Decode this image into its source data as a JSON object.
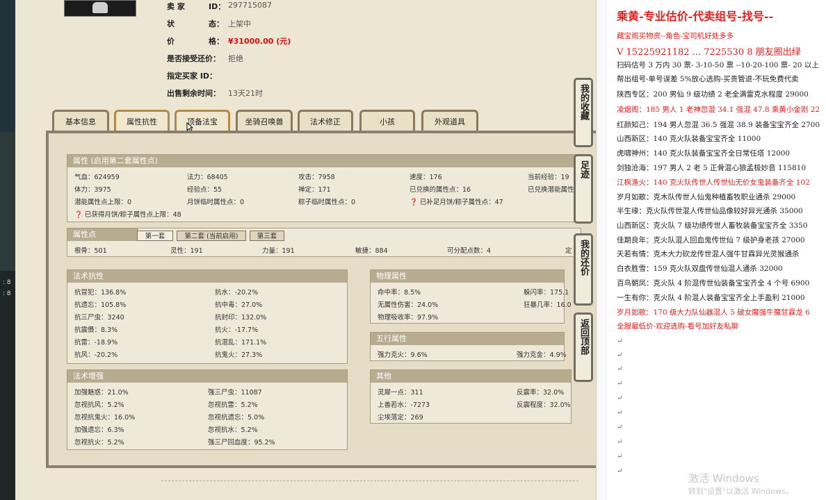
{
  "seller_info": {
    "seller_label": "卖    家",
    "id_label": "ID：",
    "id_value": "297715087",
    "status_label": "状",
    "status_label2": "态：",
    "status_value": "上架中",
    "price_label": "价",
    "price_label2": "格：",
    "price_value": "¥31000.00 (元)",
    "counter_label": "是否接受还价：",
    "counter_value": "拒绝",
    "buyer_label": "指定买家 ID：",
    "time_label": "出售剩余时间：",
    "time_value": "13天21时"
  },
  "tabs": [
    "基本信息",
    "属性抗性",
    "顶备法宝",
    "坐骑召唤兽",
    "法术修正",
    "小孩",
    "外观道具"
  ],
  "attributes": {
    "header": "属性 (启用第二套属性点)",
    "cells": [
      "气血：624959",
      "法力：68405",
      "攻击：7958",
      "速度：176",
      "当前经验：19",
      "体力：3975",
      "经验点：55",
      "禅定：171",
      "已兑换的属性点：16",
      "已兑换潜能属性",
      "潜能属性点上限：0",
      "月饼临时属性点：0",
      "粽子临时属性点：0",
      "已补足月饼/粽子属性点：47"
    ],
    "note": "已获得月饼/粽子属性点上限：48"
  },
  "points": {
    "header": "属性点",
    "subtabs": [
      "第一套",
      "第二套 (当前启用)",
      "第三套"
    ],
    "cells": [
      "根骨：501",
      "灵性：191",
      "力量：191",
      "敏捷：884",
      "可分配点数：4",
      "定"
    ]
  },
  "magic_resist": {
    "header": "法术抗性",
    "cells": [
      "抗冒犯：136.8%",
      "抗水：-20.2%",
      "抗遗忘：105.8%",
      "抗中毒：27.0%",
      "抗三尸虫：3240",
      "抗封印：132.0%",
      "抗震慑：8.3%",
      "抗火：-17.7%",
      "抗雷：-18.9%",
      "抗混乱：171.1%",
      "抗风：-20.2%",
      "抗鬼火：27.3%"
    ]
  },
  "physical": {
    "header": "物理属性",
    "cells": [
      "命中率：8.5%",
      "躲闪率：175.1",
      "无属性伤害：24.0%",
      "狂暴几率：16.0",
      "物理吸收率：97.9%"
    ]
  },
  "magic_boost": {
    "header": "法术增强",
    "cells": [
      "加强魅惑：21.0%",
      "强三尸虫：11087",
      "忽视抗风：5.2%",
      "忽视抗雷：5.2%",
      "忽视抗鬼火：16.0%",
      "忽视抗遗忘：5.0%",
      "加强遗忘：6.3%",
      "忽视抗水：5.2%",
      "忽视抗火：5.2%",
      "强三尸回血度：95.2%"
    ]
  },
  "five_elements": {
    "header": "五行属性",
    "cells": [
      "强力克火：9.6%",
      "强力克金：4.9%"
    ]
  },
  "other": {
    "header": "其他",
    "cells": [
      "灵犀一点：311",
      "反震率：32.0%",
      "上善若水：-7273",
      "反震程度：32.0%",
      "尘埃落定：269"
    ]
  },
  "float_buttons": [
    "我的收藏",
    "足迹",
    "我的还价",
    "返回顶部"
  ],
  "doc": {
    "title": "乘黄-专业估价-代卖组号-找号--",
    "lines": [
      {
        "text": "藏宝阁买物资--角色-宝司机好处多多",
        "red": true
      },
      {
        "text": "V 15225921182   ... 7225530 8 朋友圈出绿",
        "red": true,
        "big": true
      },
      {
        "text": "扫码估号 3 万内 30 票- 3-10-50 票   --10-20-100 票- 20 以上",
        "red": false
      },
      {
        "text": "帮出组号-单号误差 5%放心选购-买贵管退-不玩免费代卖",
        "red": false
      },
      {
        "text": "陕西专区：200 男仙 9 级功绩 2 老全满雷克水程度 29000",
        "red": false
      },
      {
        "text": "凌烟阁：185 男人 1 老神忽混 34.1 强混 47.8 乘黄小金刚 22",
        "red": true
      },
      {
        "text": "红颜知己：194 男人忽混 36.5 强混 38.9 装备宝宝齐全 2700",
        "red": false
      },
      {
        "text": "山西新区：140 克火队装备宝宝齐全 11000",
        "red": false
      },
      {
        "text": "虎啸神州：140 克火队装备宝宝齐全日常任塔 12000",
        "red": false
      },
      {
        "text": "剑独沧海：197 男人 2 老 5 正骨混心狼孟极妙音 115810",
        "red": false
      },
      {
        "text": "江枫渔火：140 克火队传世人传世仙无价女鬼装备齐全 102",
        "red": true
      },
      {
        "text": "岁月如歌：克木队传世人仙鬼种植畜牧职业通杀 29000",
        "red": false
      },
      {
        "text": "半生缘：克火队传世混人传世仙品像较好异光通杀 35000",
        "red": false
      },
      {
        "text": "山西新区：克火队 7 级功绩传世人畜牧装备宝宝齐全 3350",
        "red": false
      },
      {
        "text": "佳期良年：克火队混人回血鬼传世仙 7 级护身老孩 27000",
        "red": false
      },
      {
        "text": "天若有情：克木大力砍龙传世混人强牛甘霖异光灵猴通杀",
        "red": false
      },
      {
        "text": "白衣胜雪：159 克火队双盘传世仙混人通杀 32000",
        "red": false
      },
      {
        "text": "百鸟朝凤：克火队 4 阶混传世仙装备宝宝齐全 4 个号 6900",
        "red": false
      },
      {
        "text": "一生有你：克火队 4 阶混人装备宝宝齐全上手盈利 21000",
        "red": false
      },
      {
        "text": "岁月如歌：170 级大力队仙器混人 5 破女魔强牛魔甘霖龙 6",
        "red": true
      },
      {
        "text": "全服最低价-欢迎选购-看号加好友私聊",
        "red": true
      }
    ],
    "para_marks": [
      "↵",
      "↵",
      "↵",
      "↵",
      "↵",
      "↵",
      "↵",
      "↵",
      "↵",
      "↵"
    ]
  },
  "watermark": {
    "line1": "激活 Windows",
    "line2": "转到\"设置\"以激活 Windows。"
  },
  "left_labels": [
    ": 8",
    ": 8"
  ]
}
